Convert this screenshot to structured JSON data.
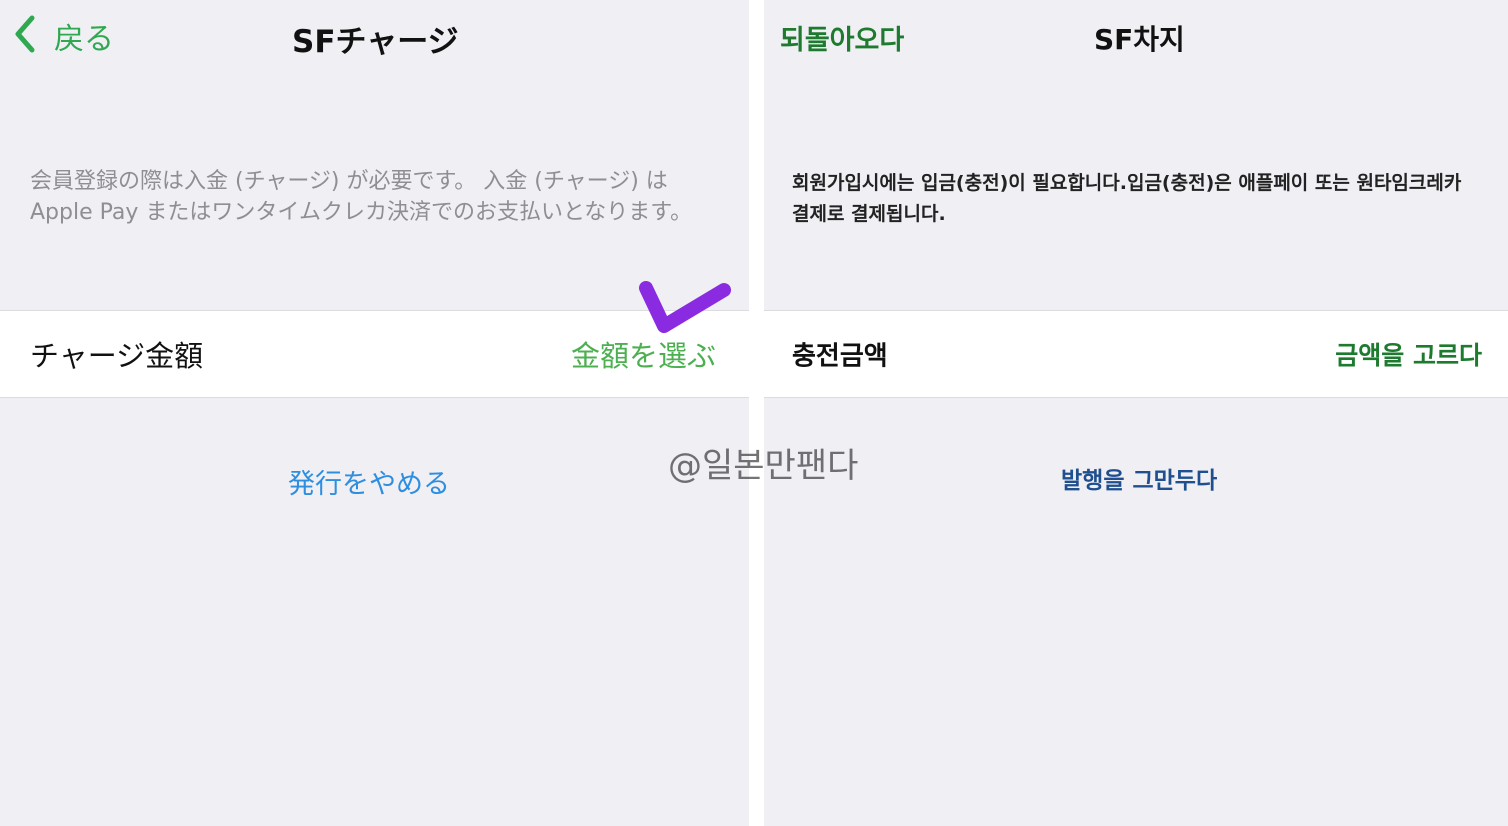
{
  "left": {
    "nav": {
      "back_label": "戻る",
      "title": "SFチャージ"
    },
    "description": "会員登録の際は入金 (チャージ) が必要です。 入金 (チャージ) は Apple Pay またはワンタイムクレカ決済でのお支払いとなります。",
    "row": {
      "label": "チャージ金額",
      "action": "金額を選ぶ"
    },
    "cancel_label": "発行をやめる"
  },
  "right": {
    "nav": {
      "back_label": "되돌아오다",
      "title": "SF차지"
    },
    "description": "회원가입시에는 입금(충전)이 필요합니다.입금(충전)은 애플페이 또는 원타임크레카 결제로 결제됩니다.",
    "row": {
      "label": "충전금액",
      "action": "금액을 고르다"
    },
    "cancel_label": "발행을 그만두다"
  },
  "watermark": "@일본만팬다",
  "colors": {
    "background": "#efeff4",
    "accent_green": "#4cb050",
    "accent_dark_green": "#1d7a2e",
    "link_blue": "#2e8ee0",
    "link_dark_blue": "#1f4f8f",
    "check_mark": "#8a2be2"
  },
  "icons": {
    "back": "chevron-left-icon",
    "annotation": "checkmark-icon"
  }
}
